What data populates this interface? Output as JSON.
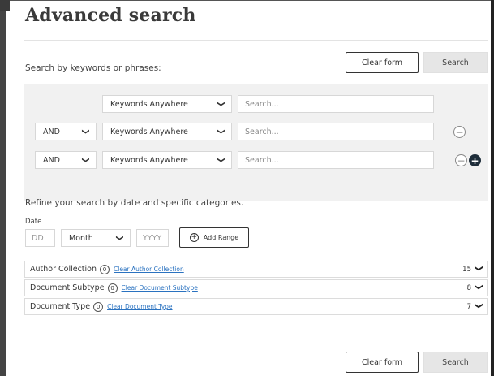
{
  "page": {
    "title": "Advanced search"
  },
  "actions": {
    "clear_form": "Clear form",
    "search": "Search"
  },
  "keywords": {
    "heading": "Search by keywords or phrases:",
    "rows": [
      {
        "operator": "",
        "field": "Keywords Anywhere",
        "placeholder": "Search..."
      },
      {
        "operator": "AND",
        "field": "Keywords Anywhere",
        "placeholder": "Search..."
      },
      {
        "operator": "AND",
        "field": "Keywords Anywhere",
        "placeholder": "Search..."
      }
    ]
  },
  "refine": {
    "heading": "Refine your search by date and specific categories.",
    "date_label": "Date",
    "day_placeholder": "DD",
    "month_value": "Month",
    "year_placeholder": "YYYY",
    "add_range": "Add Range"
  },
  "categories": [
    {
      "name": "Author Collection",
      "badge": "0",
      "clear": "Clear Author Collection",
      "count": "15"
    },
    {
      "name": "Document Subtype",
      "badge": "0",
      "clear": "Clear Document Subtype",
      "count": "8"
    },
    {
      "name": "Document Type",
      "badge": "0",
      "clear": "Clear Document Type",
      "count": "7"
    }
  ],
  "icons": {
    "select_chevron": "chevron-down-icon",
    "remove_row": "minus-circle-icon",
    "add_row": "plus-circle-icon",
    "add_range": "plus-circle-icon"
  },
  "colors": {
    "link": "#2a72c0",
    "panel_bg": "#f1f1f1",
    "add_button": "#1e2d3a"
  }
}
